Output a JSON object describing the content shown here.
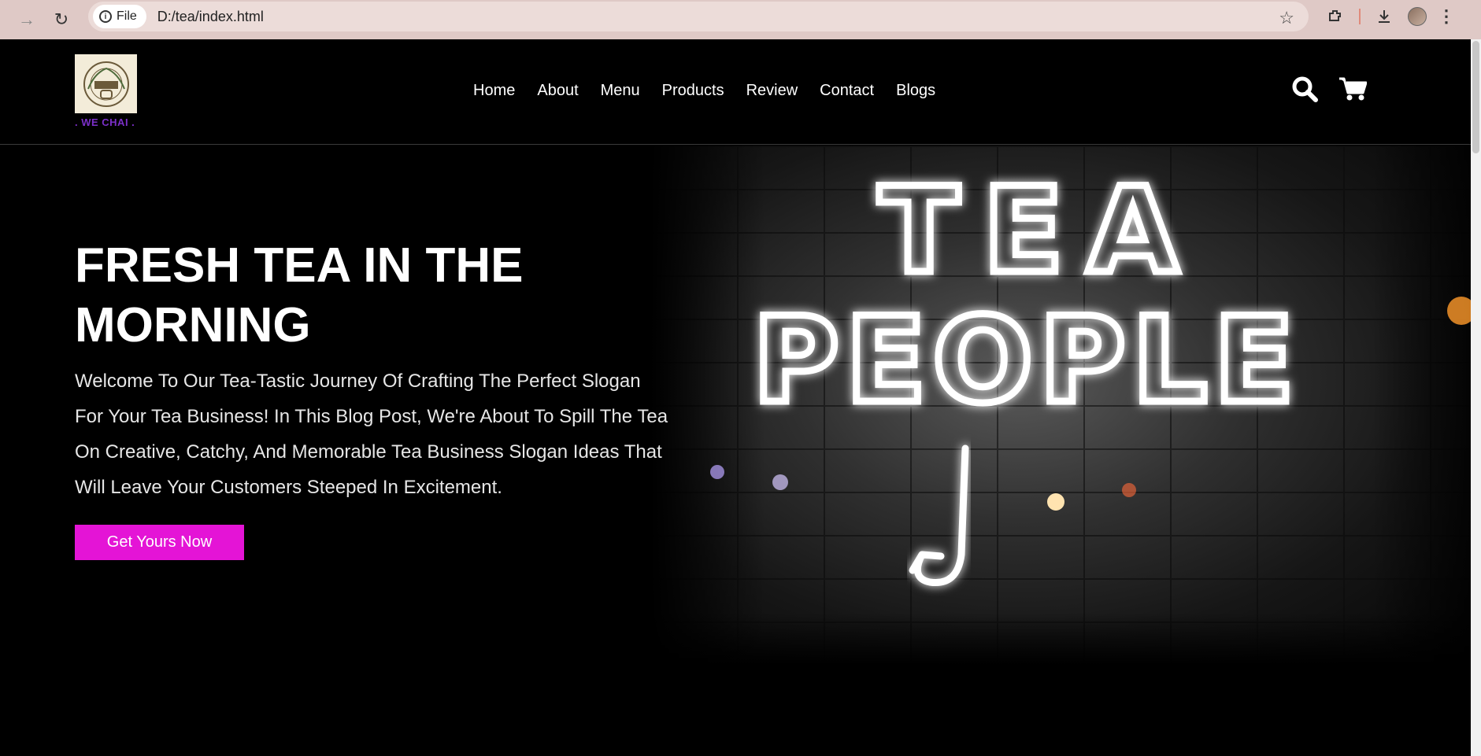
{
  "browser": {
    "chip_label": "File",
    "url": "D:/tea/index.html",
    "icons": [
      "forward-icon",
      "reload-icon",
      "info-icon",
      "star-icon",
      "extensions-icon",
      "download-icon",
      "profile-avatar",
      "more-icon"
    ]
  },
  "header": {
    "logo_tagline": ". WE CHAI .",
    "nav": [
      "Home",
      "About",
      "Menu",
      "Products",
      "Review",
      "Contact",
      "Blogs"
    ],
    "icons": [
      "search-icon",
      "cart-icon"
    ]
  },
  "hero": {
    "title": "FRESH TEA IN THE MORNING",
    "text": "Welcome To Our Tea-Tastic Journey Of Crafting The Perfect Slogan For Your Tea Business! In This Blog Post, We're About To Spill The Tea On Creative, Catchy, And Memorable Tea Business Slogan Ideas That Will Leave Your Customers Steeped In Excitement.",
    "button_label": "Get Yours Now",
    "image_sign_words": [
      "TEA",
      "PEOPLE"
    ]
  },
  "colors": {
    "button": "#e414d6",
    "tagline": "#7b2fc9",
    "background": "#000000"
  }
}
